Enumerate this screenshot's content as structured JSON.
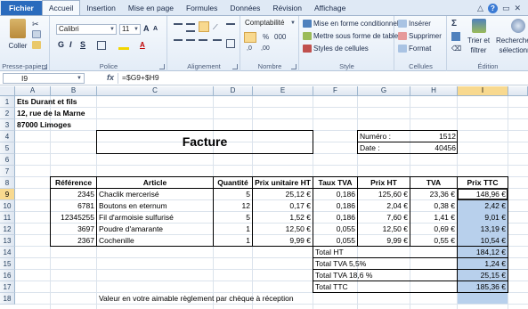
{
  "ribbon_tabs": [
    "Fichier",
    "Accueil",
    "Insertion",
    "Mise en page",
    "Formules",
    "Données",
    "Révision",
    "Affichage"
  ],
  "window_controls": {
    "minimize": "△",
    "help": "?",
    "restore": "▭",
    "close": "✕"
  },
  "clipboard": {
    "paste": "Coller",
    "group_label": "Presse-papiers"
  },
  "font": {
    "name": "Calibri",
    "size": "11",
    "bold": "G",
    "italic": "I",
    "underline": "S",
    "grow": "A",
    "shrink": "A",
    "group_label": "Police"
  },
  "alignment": {
    "group_label": "Alignement"
  },
  "number": {
    "format": "Comptabilité",
    "percent": "%",
    "thousands": "000",
    "group_label": "Nombre"
  },
  "style": {
    "conditional": "Mise en forme conditionnelle",
    "table": "Mettre sous forme de tableau",
    "cell_styles": "Styles de cellules",
    "group_label": "Style"
  },
  "cells": {
    "insert": "Insérer",
    "delete": "Supprimer",
    "format": "Format",
    "group_label": "Cellules"
  },
  "editing": {
    "sigma": "Σ",
    "sort": "Trier et",
    "sort2": "filtrer",
    "find": "Rechercher et",
    "find2": "sélectionner",
    "group_label": "Édition"
  },
  "formula_bar": {
    "name_box": "I9",
    "fx": "fx",
    "formula": "=$G9+$H9"
  },
  "columns": [
    "A",
    "B",
    "C",
    "D",
    "E",
    "F",
    "G",
    "H",
    "I"
  ],
  "selected_column": "I",
  "rows": [
    "1",
    "2",
    "3",
    "4",
    "5",
    "6",
    "7",
    "8",
    "9",
    "10",
    "11",
    "12",
    "13",
    "14",
    "15",
    "16",
    "17",
    "18"
  ],
  "selected_row": "9",
  "sheet": {
    "company": [
      "Ets Durant et fils",
      "12, rue de la Marne",
      "87000 Limoges"
    ],
    "invoice_title": "Facture",
    "numero_label": "Numéro :",
    "numero_value": "1512",
    "date_label": "Date :",
    "date_value": "40456",
    "headers": [
      "Référence",
      "Article",
      "Quantité",
      "Prix unitaire HT",
      "Taux TVA",
      "Prix HT",
      "TVA",
      "Prix TTC"
    ],
    "items": [
      {
        "ref": "2345",
        "article": "Chaclik mercerisé",
        "qty": "5",
        "pu": "25,12 €",
        "taux": "0,186",
        "ht": "125,60 €",
        "tva": "23,36 €",
        "ttc": "148,96 €"
      },
      {
        "ref": "6781",
        "article": "Boutons en eternum",
        "qty": "12",
        "pu": "0,17 €",
        "taux": "0,186",
        "ht": "2,04 €",
        "tva": "0,38 €",
        "ttc": "2,42 €"
      },
      {
        "ref": "12345255",
        "article": "Fil d'armoisie sulfurisé",
        "qty": "5",
        "pu": "1,52 €",
        "taux": "0,186",
        "ht": "7,60 €",
        "tva": "1,41 €",
        "ttc": "9,01 €"
      },
      {
        "ref": "3697",
        "article": "Poudre d'amarante",
        "qty": "1",
        "pu": "12,50 €",
        "taux": "0,055",
        "ht": "12,50 €",
        "tva": "0,69 €",
        "ttc": "13,19 €"
      },
      {
        "ref": "2367",
        "article": "Cochenille",
        "qty": "1",
        "pu": "9,99 €",
        "taux": "0,055",
        "ht": "9,99 €",
        "tva": "0,55 €",
        "ttc": "10,54 €"
      }
    ],
    "totals": [
      {
        "label": "Total HT",
        "value": "184,12 €"
      },
      {
        "label": "Total TVA 5,5%",
        "value": "1,24 €"
      },
      {
        "label": "Total TVA 18,6 %",
        "value": "25,15 €"
      },
      {
        "label": "Total TTC",
        "value": "185,36 €"
      }
    ],
    "footer_note": "Valeur en votre aimable règlement par chèque à réception"
  }
}
